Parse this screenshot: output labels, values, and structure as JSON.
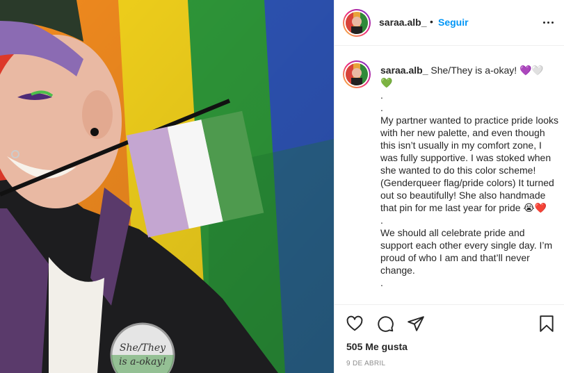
{
  "post": {
    "username": "saraa.alb_",
    "separator": "•",
    "follow_label": "Seguir",
    "more_icon": "more-options-icon"
  },
  "caption": {
    "username": "saraa.alb_",
    "text": " She/They is a-okay! 💜🤍\n💚\n.\n.\nMy partner wanted to practice pride looks with her new palette, and even though this isn’t usually in my comfort zone, I was fully supportive. I was stoked when she wanted to do this color scheme! (Genderqueer flag/pride colors) It turned out so beautifully! She also handmade that pin for me last year for pride 😭❤️\n.\nWe should all celebrate pride and support each other every single day. I’m proud of who I am and that’ll never change.\n."
  },
  "photo": {
    "pin_text_line1": "She/They",
    "pin_text_line2": "is a-okay!"
  },
  "actions": {
    "icons": [
      "heart-icon",
      "comment-icon",
      "share-icon",
      "bookmark-icon"
    ]
  },
  "likes_label": "505 Me gusta",
  "date_label": "9 DE ABRIL",
  "colors": {
    "accent_blue": "#0095f6",
    "text": "#262626",
    "secondary": "#8e8e8e",
    "border": "#efefef"
  }
}
